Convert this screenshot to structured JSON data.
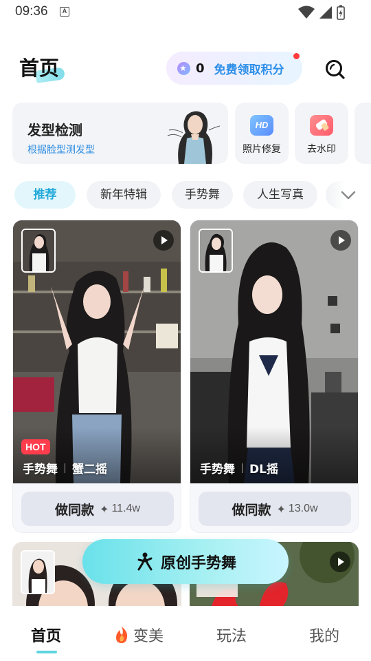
{
  "status_bar": {
    "time": "09:36",
    "notification_glyph": "A"
  },
  "header": {
    "title": "首页",
    "points": {
      "count": "0",
      "label": "免费领取积分"
    }
  },
  "features": {
    "main": {
      "title": "发型检测",
      "subtitle": "根据脸型测发型"
    },
    "items": [
      {
        "label": "照片修复",
        "icon": "hd-icon",
        "badge": "HD"
      },
      {
        "label": "去水印",
        "icon": "eraser-icon"
      }
    ]
  },
  "tabs": [
    "推荐",
    "新年特辑",
    "手势舞",
    "人生写真"
  ],
  "cards": [
    {
      "hot": "HOT",
      "tag1": "手势舞",
      "tag2": "蟹二摇",
      "button": "做同款",
      "spark": "✦",
      "count": "11.4w"
    },
    {
      "tag1": "手势舞",
      "tag2": "DL摇",
      "button": "做同款",
      "spark": "✦",
      "count": "13.0w"
    }
  ],
  "float_banner": {
    "label": "原创手势舞"
  },
  "bottom_nav": [
    "首页",
    "变美",
    "玩法",
    "我的"
  ],
  "colors": {
    "accent": "#22a9d8",
    "link": "#2d8ee8",
    "hot": "#ff3d4d",
    "indicator": "#5fd5e0"
  }
}
